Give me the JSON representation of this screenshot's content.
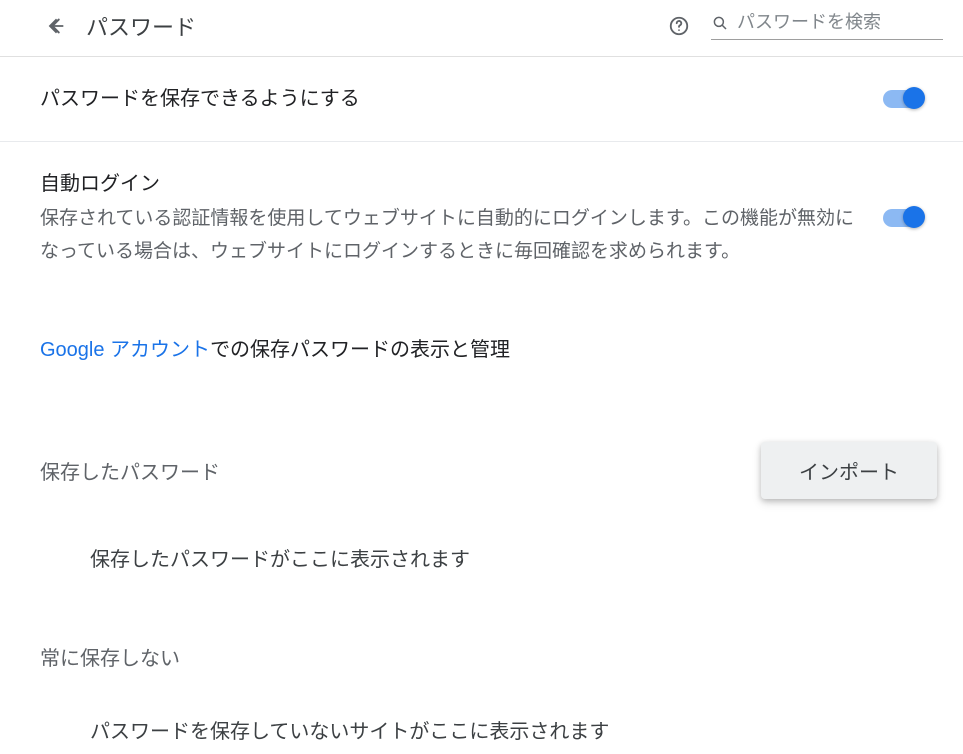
{
  "header": {
    "title": "パスワード",
    "search_placeholder": "パスワードを検索"
  },
  "settings": {
    "offer_save": {
      "title": "パスワードを保存できるようにする",
      "enabled": true
    },
    "auto_signin": {
      "title": "自動ログイン",
      "description": "保存されている認証情報を使用してウェブサイトに自動的にログインします。この機能が無効になっている場合は、ウェブサイトにログインするときに毎回確認を求められます。",
      "enabled": true
    }
  },
  "google_account": {
    "link_text": "Google アカウント",
    "rest_text": "での保存パスワードの表示と管理"
  },
  "saved": {
    "header": "保存したパスワード",
    "import_label": "インポート",
    "empty_message": "保存したパスワードがここに表示されます"
  },
  "never": {
    "header": "常に保存しない",
    "empty_message": "パスワードを保存していないサイトがここに表示されます"
  }
}
